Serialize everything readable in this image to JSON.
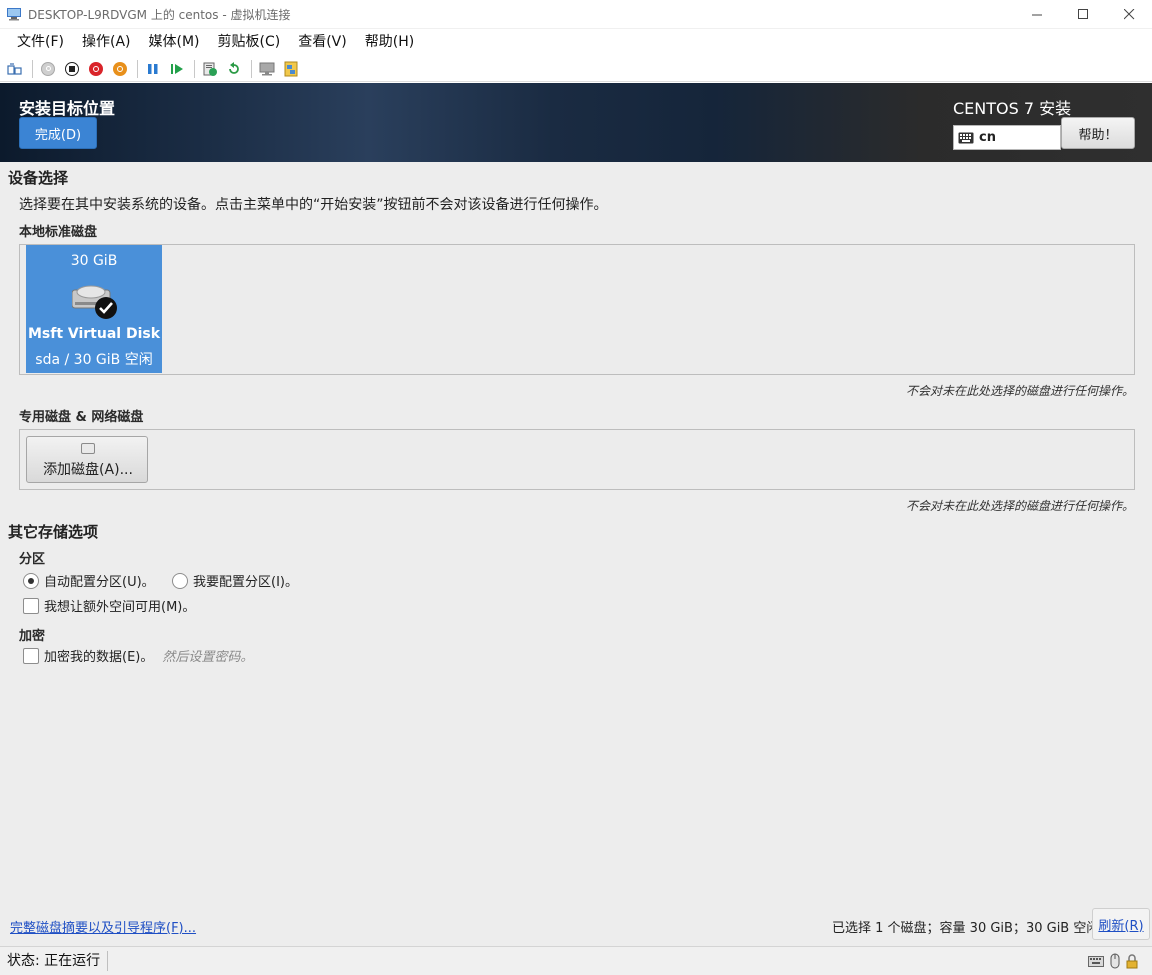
{
  "window": {
    "title": "DESKTOP-L9RDVGM 上的 centos - 虚拟机连接",
    "controls": [
      "minimize-icon",
      "maximize-icon",
      "close-icon"
    ]
  },
  "menubar": {
    "items": [
      "文件(F)",
      "操作(A)",
      "媒体(M)",
      "剪贴板(C)",
      "查看(V)",
      "帮助(H)"
    ]
  },
  "toolbar": {
    "icons": [
      "ctrl-alt-del-icon",
      "start-icon",
      "turn-off-icon",
      "shutdown-icon",
      "power-icon",
      "pause-icon",
      "resume-icon",
      "checkpoint-icon",
      "revert-icon",
      "enhanced-session-icon",
      "share-icon"
    ]
  },
  "header": {
    "screen_title": "安装目标位置",
    "done_button": "完成(D)",
    "product": "CENTOS 7 安装",
    "keyboard_layout": "cn",
    "help_button": "帮助！"
  },
  "device_selection": {
    "title": "设备选择",
    "description": "选择要在其中安装系统的设备。点击主菜单中的“开始安装”按钮前不会对该设备进行任何操作。",
    "local_disks_title": "本地标准磁盘",
    "disk": {
      "size": "30 GiB",
      "name": "Msft Virtual Disk",
      "details": "sda  /  30 GiB 空闲",
      "selected": true
    },
    "local_note": "不会对未在此处选择的磁盘进行任何操作。",
    "specialized_title": "专用磁盘 & 网络磁盘",
    "add_disk_button": "添加磁盘(A)...",
    "specialized_note": "不会对未在此处选择的磁盘进行任何操作。"
  },
  "other_storage": {
    "title": "其它存储选项",
    "partitioning_title": "分区",
    "auto_partition": "自动配置分区(U)。",
    "manual_partition": "我要配置分区(I)。",
    "selected_partition": "auto",
    "extra_space": "我想让额外空间可用(M)。",
    "encryption_title": "加密",
    "encrypt_data": "加密我的数据(E)。",
    "encrypt_hint": "然后设置密码。"
  },
  "footer": {
    "summary_link": "完整磁盘摘要以及引导程序(F)...",
    "selection_summary": "已选择 1 个磁盘；容量 30 GiB；30 GiB 空闲",
    "refresh_button": "刷新(R)"
  },
  "statusbar": {
    "status": "状态: 正在运行"
  },
  "colors": {
    "accent": "#4a90d9",
    "done_button": "#3b84d4",
    "link": "#1f4fc4",
    "header_dark": "#2b2b2b"
  }
}
